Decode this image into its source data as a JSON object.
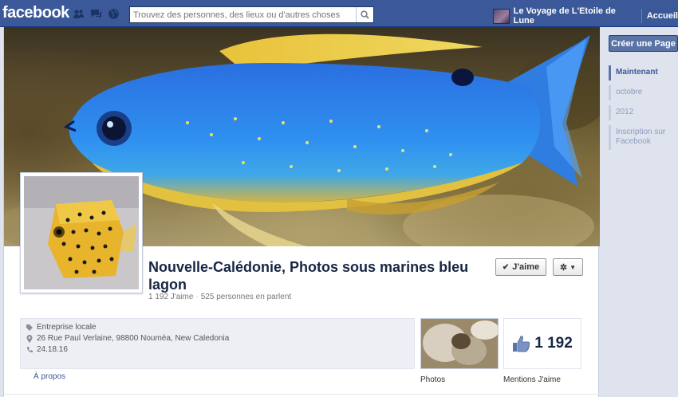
{
  "topbar": {
    "logo": "facebook",
    "search": {
      "placeholder": "Trouvez des personnes, des lieux ou d'autres choses",
      "value": ""
    },
    "account_name": "Le Voyage de L'Etoile de Lune",
    "home_label": "Accueil"
  },
  "page": {
    "title": "Nouvelle-Calédonie, Photos sous marines bleu lagon",
    "likes_text": "1 192 J'aime",
    "talking_text": "525 personnes en parlent",
    "like_button": "J'aime",
    "category": "Entreprise locale",
    "address": "26 Rue Paul Verlaine, 98800 Nouméa, New Caledonia",
    "phone": "24.18.16",
    "about_link": "À propos",
    "photos_label": "Photos",
    "likes_count": "1 192",
    "likes_label": "Mentions J'aime"
  },
  "sidebar": {
    "create_page": "Créer une Page",
    "timeline": [
      {
        "label": "Maintenant",
        "active": true
      },
      {
        "label": "octobre",
        "active": false
      },
      {
        "label": "2012",
        "active": false
      },
      {
        "label": "Inscription sur Facebook",
        "active": false
      }
    ]
  },
  "colors": {
    "brand": "#3b5998",
    "fish_blue": "#2f7de0",
    "fish_yellow": "#e8c23a"
  }
}
